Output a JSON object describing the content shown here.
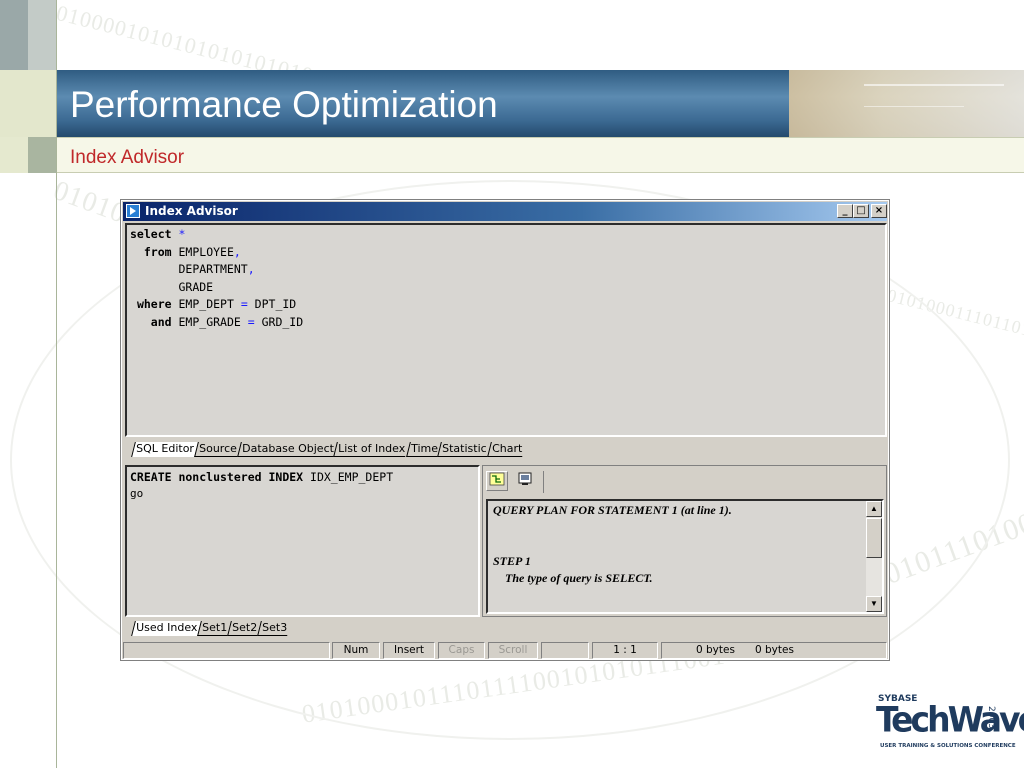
{
  "slide": {
    "title": "Performance Optimization",
    "subtitle": "Index Advisor",
    "accent_color": "#c0282a",
    "title_band_color": "#3c6a93"
  },
  "window": {
    "title": "Index Advisor",
    "icon": "app-icon",
    "controls": [
      "minimize-icon",
      "maximize-icon",
      "close-icon"
    ]
  },
  "sql_editor": {
    "lines": [
      {
        "kw": "select",
        "rest": "*"
      },
      {
        "kw": "from",
        "rest": "EMPLOYEE,"
      },
      {
        "kw": "",
        "rest": "DEPARTMENT,"
      },
      {
        "kw": "",
        "rest": "GRADE"
      },
      {
        "kw": "where",
        "rest": "EMP_DEPT = DPT_ID"
      },
      {
        "kw": "and",
        "rest": "EMP_GRADE = GRD_ID"
      }
    ]
  },
  "editor_tabs": [
    "SQL Editor",
    "Source",
    "Database Object",
    "List of Index",
    "Time",
    "Statistic",
    "Chart"
  ],
  "index_output": {
    "line1_kw": "CREATE nonclustered INDEX",
    "line1_name": "IDX_EMP_DEPT",
    "line2": "go"
  },
  "plan_toolbar": [
    "plan-tree-icon",
    "plan-text-icon"
  ],
  "query_plan": {
    "lines": [
      "QUERY PLAN FOR STATEMENT 1 (at line 1).",
      "",
      "",
      "STEP 1",
      "    The type of query is SELECT."
    ]
  },
  "result_tabs": [
    "Used Index",
    "Set1",
    "Set2",
    "Set3"
  ],
  "status_bar": {
    "num": "Num",
    "insert": "Insert",
    "caps": "Caps",
    "scroll": "Scroll",
    "position": "1 : 1",
    "bytes1": "0 bytes",
    "bytes2": "0 bytes"
  },
  "logo": {
    "brand": "SYBASE",
    "name": "TechWave",
    "year": "2003",
    "tagline": "USER TRAINING & SOLUTIONS CONFERENCE"
  }
}
